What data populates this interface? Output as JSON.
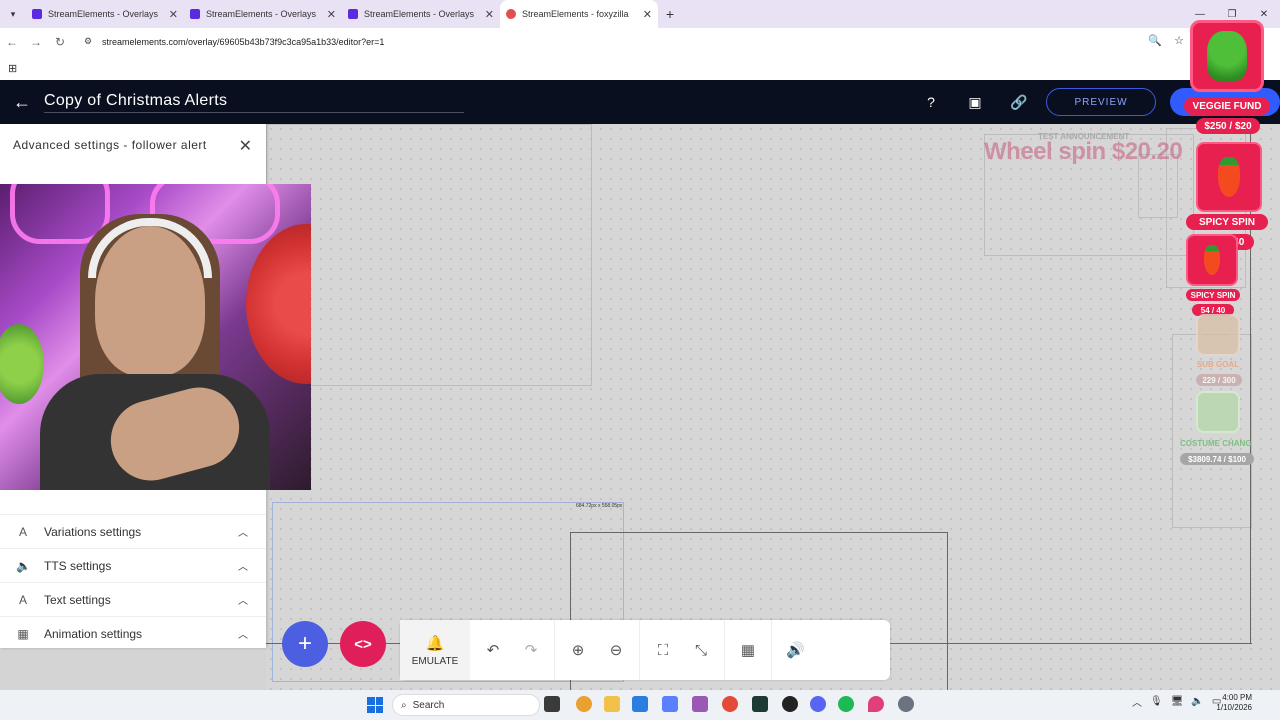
{
  "browser": {
    "tabs": [
      {
        "title": "StreamElements - Overlays",
        "active": false
      },
      {
        "title": "StreamElements - Overlays",
        "active": false
      },
      {
        "title": "StreamElements - Overlays",
        "active": false
      },
      {
        "title": "StreamElements - foxyzilla",
        "active": true
      }
    ],
    "url": "streamelements.com/overlay/69605b43b73f9c3ca95a1b33/editor?er=1"
  },
  "app": {
    "title": "Copy of Christmas Alerts",
    "preview_label": "PREVIEW"
  },
  "panel": {
    "header": "Advanced settings - follower alert",
    "sections": [
      {
        "label": "Variations settings",
        "icon": "text-icon"
      },
      {
        "label": "TTS settings",
        "icon": "speaker-icon"
      },
      {
        "label": "Text settings",
        "icon": "text-icon"
      },
      {
        "label": "Animation settings",
        "icon": "animation-icon"
      }
    ]
  },
  "canvas": {
    "wheel_text": "Wheel spin $20.20",
    "test_announcement": "TEST ANNOUNCEMENT",
    "selection_size": "684.72px x 558.05px"
  },
  "widgets": {
    "veggie_fund_label": "VEGGIE FUND",
    "veggie_fund_value": "$250 / $20",
    "spicy_spin_label": "SPICY SPIN",
    "spicy_spin_value": "55 / 40",
    "spicy_spin2_label": "SPICY SPIN",
    "spicy_spin2_value": "54 / 40",
    "sub_goal_label": "SUB GOAL",
    "sub_goal_value": "229 / 300",
    "costume_label": "COSTUME CHANG",
    "costume_value": "$3809.74 / $100"
  },
  "toolbar": {
    "emulate_label": "EMULATE"
  },
  "taskbar": {
    "search_placeholder": "Search",
    "time": "4:00 PM",
    "date": "1/10/2026"
  }
}
